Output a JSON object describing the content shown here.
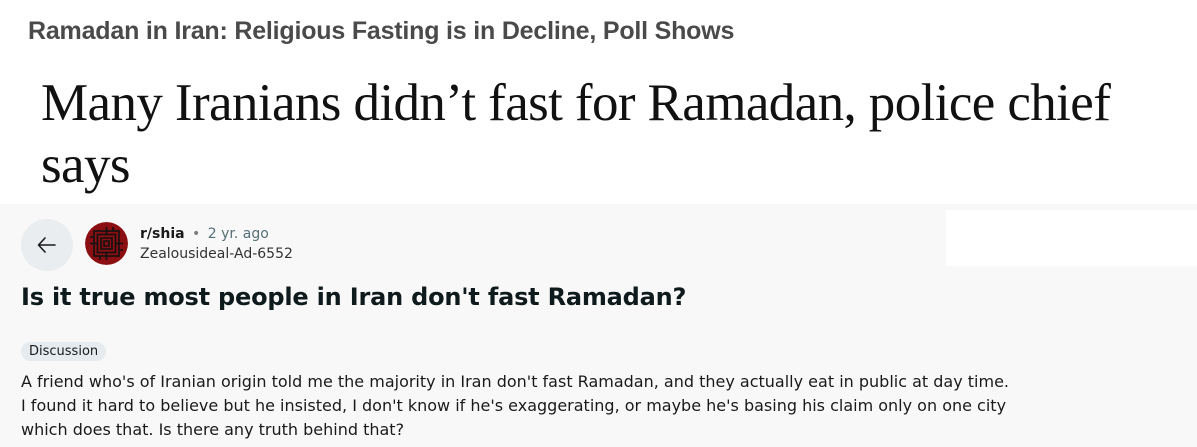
{
  "article": {
    "top_headline": "Ramadan in Iran: Religious Fasting is in Decline, Poll Shows",
    "big_headline": "Many Iranians didn’t fast for Ramadan, police chief says"
  },
  "post": {
    "subreddit": "r/shia",
    "separator": "•",
    "time_ago": "2 yr. ago",
    "username": "Zealousideal-Ad-6552",
    "title": "Is it true most people in Iran don't fast Ramadan?",
    "flair": "Discussion",
    "body": [
      "A friend who's of Iranian origin told me the majority in Iran don't fast Ramadan, and they actually eat in public at day time.",
      "I found it hard to believe but he insisted, I don't know if he's exaggerating, or maybe he's basing his claim only on one city",
      "which does that. Is there any truth behind that?"
    ]
  },
  "icons": {
    "back": "arrow-left-icon",
    "avatar": "subreddit-avatar"
  },
  "colors": {
    "avatar_bg": "#8b0f12",
    "avatar_fg": "#111111"
  }
}
